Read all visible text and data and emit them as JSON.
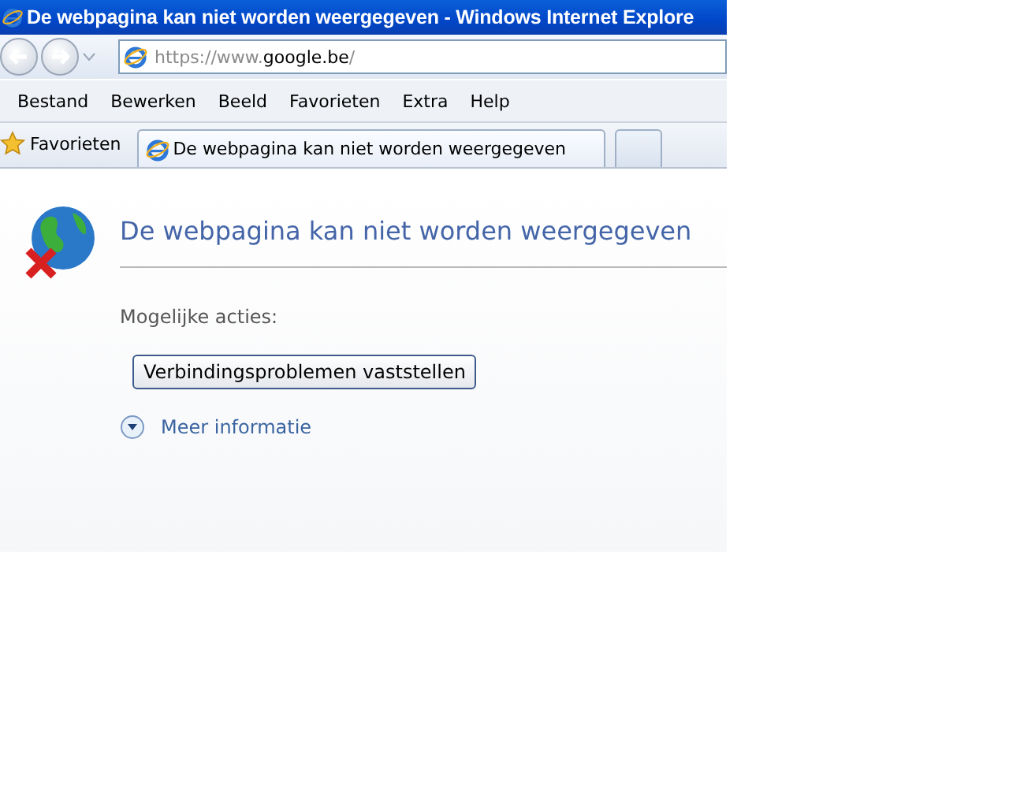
{
  "window": {
    "title": "De webpagina kan niet worden weergegeven - Windows Internet Explore"
  },
  "address_bar": {
    "url": "https://www.**google.be**/"
  },
  "menu": [
    "Bestand",
    "Bewerken",
    "Beeld",
    "Favorieten",
    "Extra",
    "Help"
  ],
  "favorites_bar": {
    "label": "Favorieten"
  },
  "tabs": [
    {
      "kind": "page",
      "label": "De webpagina kan niet worden weergegeven",
      "selected": true
    },
    {
      "kind": "new",
      "selected": false
    }
  ],
  "content": {
    "heading": "De webpagina kan niet worden weergegeven",
    "actions_label": "Mogelijke acties:",
    "button": "Verbindingsproblemen vaststellen",
    "more_info": {
      "label": "Meer informatie",
      "expanded": false
    }
  }
}
